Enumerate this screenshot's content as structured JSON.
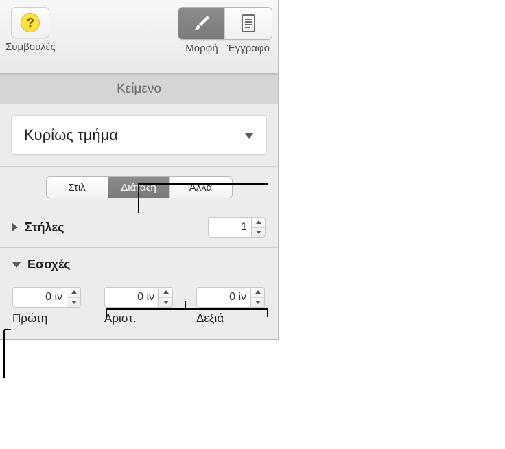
{
  "toolbar": {
    "tips_label": "Συμβουλές",
    "format_label": "Μορφή",
    "document_label": "Έγγραφο",
    "tips_badge": "?"
  },
  "section_title": "Κείμενο",
  "style_dropdown": {
    "value": "Κυρίως τμήμα"
  },
  "tabs": {
    "style": "Στιλ",
    "layout": "Διάταξη",
    "more": "Άλλα",
    "active": "layout"
  },
  "columns": {
    "label": "Στήλες",
    "value": "1"
  },
  "indents": {
    "label": "Εσοχές",
    "unit_suffix": " ίν",
    "first": {
      "value": "0",
      "label": "Πρώτη"
    },
    "left": {
      "value": "0",
      "label": "Αριστ."
    },
    "right": {
      "value": "0",
      "label": "Δεξιά"
    }
  }
}
